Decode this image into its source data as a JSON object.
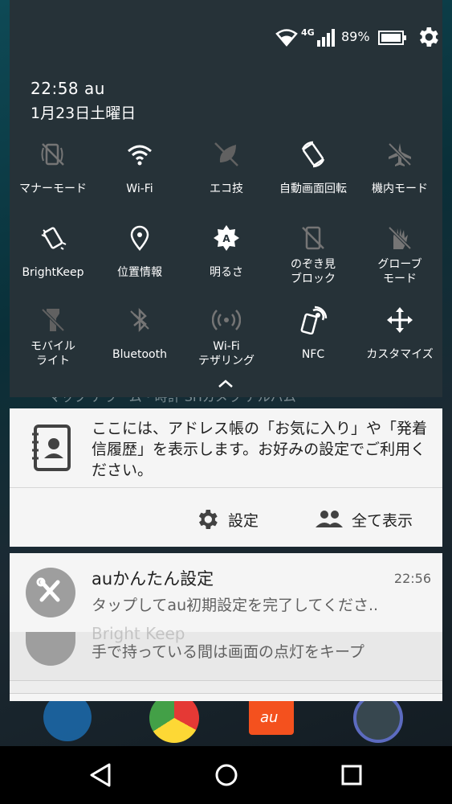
{
  "status_bar": {
    "network": "4G",
    "battery": "89%"
  },
  "header": {
    "time_carrier": "22:58  au",
    "date": "1月23日土曜日"
  },
  "quick_settings": {
    "tiles": [
      {
        "label": "マナーモード",
        "icon": "manner-mode-icon"
      },
      {
        "label": "Wi-Fi",
        "icon": "wifi-icon"
      },
      {
        "label": "エコ技",
        "icon": "eco-icon"
      },
      {
        "label": "自動画面回転",
        "icon": "auto-rotate-icon"
      },
      {
        "label": "機内モード",
        "icon": "airplane-icon"
      },
      {
        "label": "BrightKeep",
        "icon": "brightkeep-icon"
      },
      {
        "label": "位置情報",
        "icon": "location-icon"
      },
      {
        "label": "明るさ",
        "icon": "brightness-icon"
      },
      {
        "label": "のぞき見\nブロック",
        "icon": "peek-block-icon"
      },
      {
        "label": "グローブ\nモード",
        "icon": "glove-icon"
      },
      {
        "label": "モバイル\nライト",
        "icon": "flashlight-icon"
      },
      {
        "label": "Bluetooth",
        "icon": "bluetooth-icon"
      },
      {
        "label": "Wi-Fi\nテザリング",
        "icon": "tethering-icon"
      },
      {
        "label": "NFC",
        "icon": "nfc-icon"
      },
      {
        "label": "カスタマイズ",
        "icon": "customize-icon"
      }
    ]
  },
  "home_screen": {
    "labels": "マップ    アラーム・時計    SHカメラ    アルバム",
    "dock_text": "au"
  },
  "notifications": {
    "contacts": {
      "message": "ここには、アドレス帳の「お気に入り」や「発着信履歴」を表示します。お好みの設定でご利用ください。",
      "action_settings": "設定",
      "action_show_all": "全て表示"
    },
    "au_setup": {
      "title": "auかんたん設定",
      "time": "22:56",
      "body": "タップしてau初期設定を完了してくださ.."
    },
    "bright_keep": {
      "title": "Bright Keep",
      "body": "手で持っている間は画面の点灯をキープ"
    }
  },
  "colors": {
    "panel": "#263238",
    "card": "#f5f5f5",
    "icon_gray": "#9e9e9e"
  }
}
